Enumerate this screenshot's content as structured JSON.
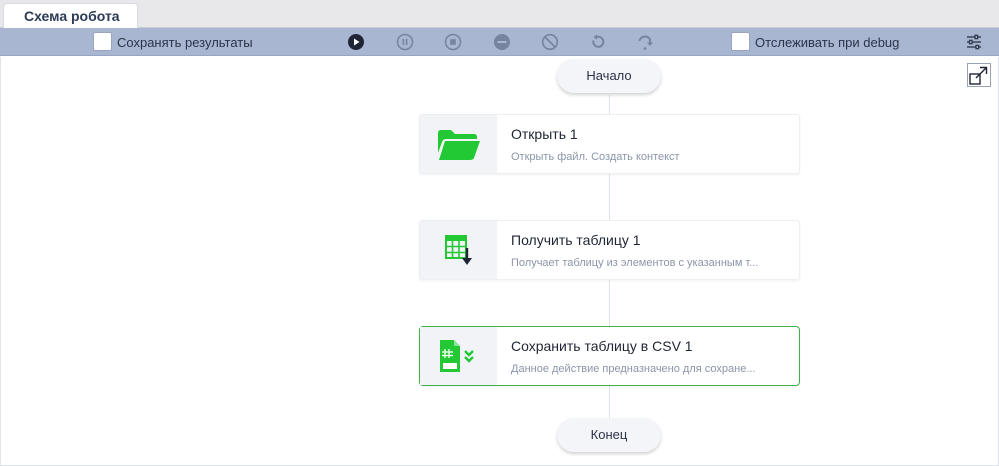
{
  "tab": {
    "label": "Схема робота"
  },
  "toolbar": {
    "save_results_label": "Сохранять результаты",
    "debug_track_label": "Отслеживать при debug",
    "buttons": [
      "play-icon",
      "pause-icon",
      "stop-icon",
      "minus-circle-icon",
      "cancel-icon",
      "undo-icon",
      "redo-icon",
      "settings-sliders-icon"
    ]
  },
  "flow": {
    "start_label": "Начало",
    "end_label": "Конец",
    "nodes": [
      {
        "title": "Открыть  1",
        "description": "Открыть файл. Создать контекст",
        "icon": "folder-open-icon"
      },
      {
        "title": "Получить таблицу  1",
        "description": "Получает таблицу из элементов с указанным т...",
        "icon": "table-download-icon"
      },
      {
        "title": "Сохранить таблицу в CSV  1",
        "description": "Данное действие предназначено для сохране...",
        "icon": "csv-file-icon",
        "selected": true
      }
    ]
  },
  "colors": {
    "toolbar": "#a9b6d1",
    "accent_green": "#22c934",
    "selected_border": "#3fb24a"
  }
}
